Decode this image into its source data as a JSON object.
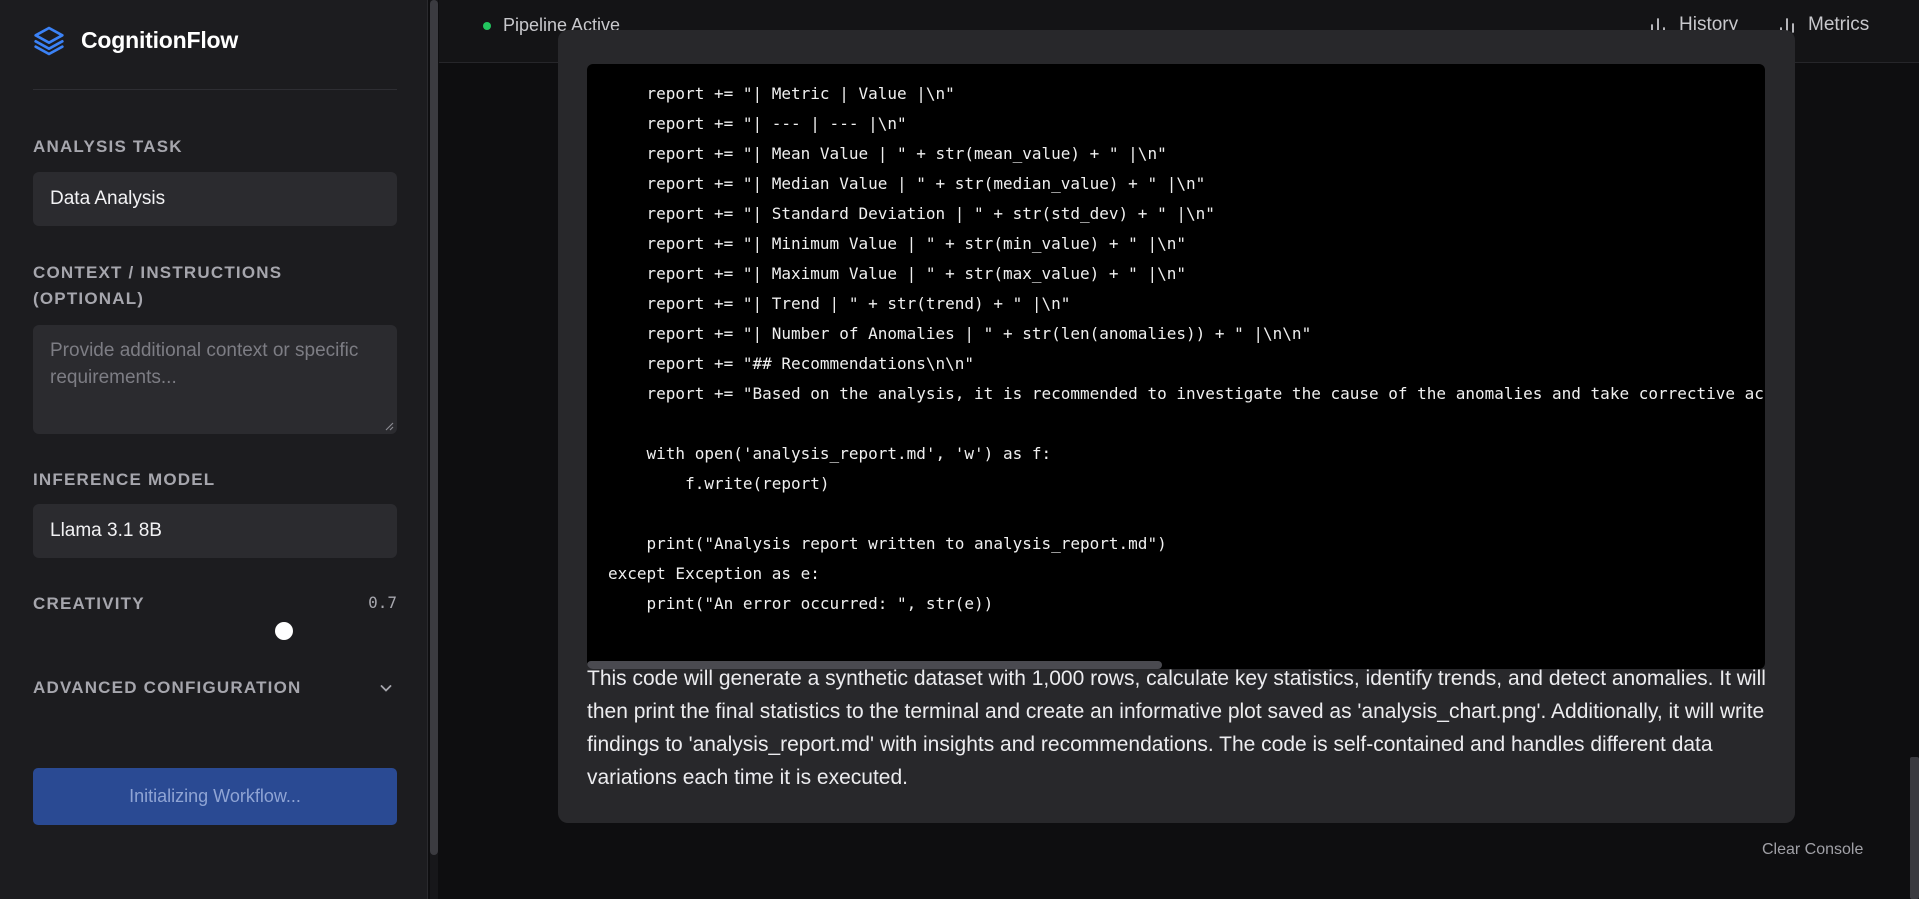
{
  "brand": {
    "name": "CognitionFlow"
  },
  "sidebar": {
    "task_label": "ANALYSIS TASK",
    "task_value": "Data Analysis",
    "context_label": "CONTEXT / INSTRUCTIONS (OPTIONAL)",
    "context_placeholder": "Provide additional context or specific requirements...",
    "model_label": "INFERENCE MODEL",
    "model_value": "Llama 3.1 8B",
    "creativity_label": "CREATIVITY",
    "creativity_value": "0.7",
    "advanced_label": "ADVANCED CONFIGURATION",
    "init_button": "Initializing Workflow..."
  },
  "topbar": {
    "status": "Pipeline Active",
    "status_color": "#22c55e",
    "history": "History",
    "metrics": "Metrics"
  },
  "code_lines": [
    "    report += \"| Metric | Value |\\n\"",
    "    report += \"| --- | --- |\\n\"",
    "    report += \"| Mean Value | \" + str(mean_value) + \" |\\n\"",
    "    report += \"| Median Value | \" + str(median_value) + \" |\\n\"",
    "    report += \"| Standard Deviation | \" + str(std_dev) + \" |\\n\"",
    "    report += \"| Minimum Value | \" + str(min_value) + \" |\\n\"",
    "    report += \"| Maximum Value | \" + str(max_value) + \" |\\n\"",
    "    report += \"| Trend | \" + str(trend) + \" |\\n\"",
    "    report += \"| Number of Anomalies | \" + str(len(anomalies)) + \" |\\n\\n\"",
    "    report += \"## Recommendations\\n\\n\"",
    "    report += \"Based on the analysis, it is recommended to investigate the cause of the anomalies and take corrective acti",
    "",
    "    with open('analysis_report.md', 'w') as f:",
    "        f.write(report)",
    "",
    "    print(\"Analysis report written to analysis_report.md\")",
    "except Exception as e:",
    "    print(\"An error occurred: \", str(e))"
  ],
  "explanation": "This code will generate a synthetic dataset with 1,000 rows, calculate key statistics, identify trends, and detect anomalies. It will then print the final statistics to the terminal and create an informative plot saved as 'analysis_chart.png'. Additionally, it will write findings to 'analysis_report.md' with insights and recommendations. The code is self-contained and handles different data variations each time it is executed.",
  "clear_console": "Clear Console",
  "creativity_level": 0.7
}
